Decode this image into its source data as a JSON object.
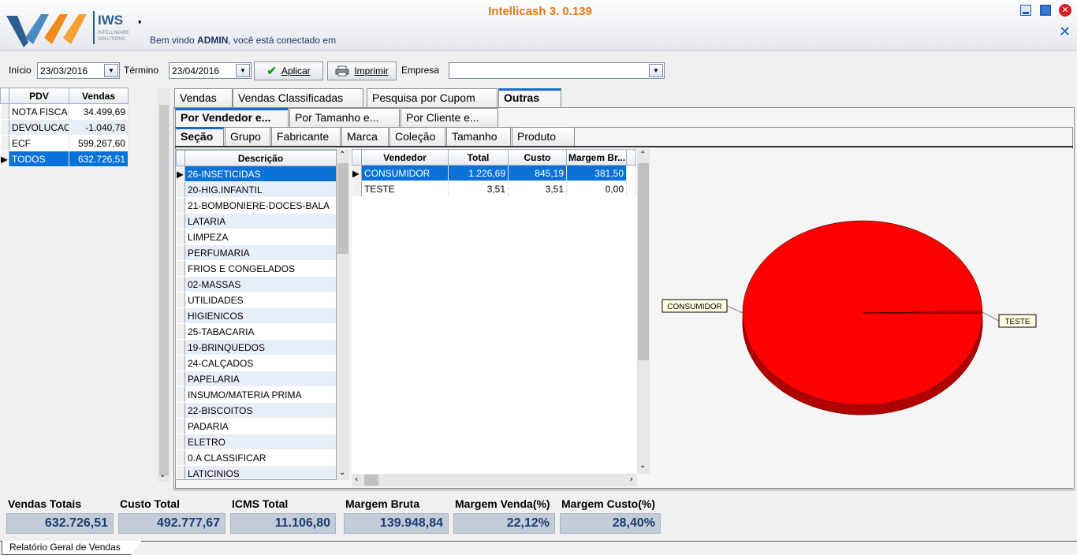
{
  "app": {
    "logo_text": "IWS",
    "logo_sub": "INTELLIWARE SOLUTIONS",
    "title": "Intellicash 3. 0.139"
  },
  "welcome": {
    "prefix": "Bem vindo ",
    "user": "ADMIN",
    "suffix": ", você está conectado em"
  },
  "filters": {
    "inicio_label": "Início",
    "inicio_value": "23/03/2016",
    "termino_label": "Término",
    "termino_value": "23/04/2016",
    "aplicar_label": "Aplicar",
    "imprimir_label": "Imprimir",
    "empresa_label": "Empresa",
    "empresa_value": ""
  },
  "pdv_table": {
    "headers": [
      "PDV",
      "Vendas"
    ],
    "rows": [
      {
        "pdv": "NOTA FISCA",
        "vendas": "34.499,69"
      },
      {
        "pdv": "DEVOLUCAO",
        "vendas": "-1.040,78"
      },
      {
        "pdv": "ECF",
        "vendas": "599.267,60"
      },
      {
        "pdv": "TODOS",
        "vendas": "632.726,51"
      }
    ]
  },
  "tabs_main": [
    "Vendas",
    "Vendas Classificadas",
    "Pesquisa por Cupom",
    "Outras"
  ],
  "tabs_sub": [
    "Por Vendedor e...",
    "Por Tamanho e...",
    "Por Cliente e..."
  ],
  "tabs_inner": [
    "Seção",
    "Grupo",
    "Fabricante",
    "Marca",
    "Coleção",
    "Tamanho",
    "Produto"
  ],
  "desc_table": {
    "header": "Descrição",
    "rows": [
      "26-INSETICIDAS",
      "20-HIG.INFANTIL",
      "21-BOMBONIERE-DOCES-BALA",
      "LATARIA",
      "LIMPEZA",
      "PERFUMARIA",
      "FRIOS E CONGELADOS",
      "02-MASSAS",
      "UTILIDADES",
      "HIGIENICOS",
      "25-TABACARIA",
      "19-BRINQUEDOS",
      "24-CALÇADOS",
      "PAPELARIA",
      "INSUMO/MATERIA PRIMA",
      "22-BISCOITOS",
      "PADARIA",
      "ELETRO",
      "0.A CLASSIFICAR",
      "LATICINIOS"
    ]
  },
  "vend_table": {
    "headers": [
      "Vendedor",
      "Total",
      "Custo",
      "Margem Br..."
    ],
    "rows": [
      {
        "vendedor": "CONSUMIDOR",
        "total": "1.226,69",
        "custo": "845,19",
        "margem": "381,50"
      },
      {
        "vendedor": "TESTE",
        "total": "3,51",
        "custo": "3,51",
        "margem": "0,00"
      }
    ]
  },
  "chart_data": {
    "type": "pie",
    "categories": [
      "CONSUMIDOR",
      "TESTE"
    ],
    "values": [
      1226.69,
      3.51
    ],
    "colors": [
      "#ff0000",
      "#ff0000"
    ]
  },
  "summary": [
    {
      "label": "Vendas Totais",
      "value": "632.726,51"
    },
    {
      "label": "Custo Total",
      "value": "492.777,67"
    },
    {
      "label": "ICMS Total",
      "value": "11.106,80"
    },
    {
      "label": "Margem Bruta",
      "value": "139.948,84"
    },
    {
      "label": "Margem Venda(%)",
      "value": "22,12%"
    },
    {
      "label": "Margem Custo(%)",
      "value": "28,40%"
    }
  ],
  "bottom_tab": "Relatório Geral de Vendas",
  "icons": [
    "logo-icon",
    "menu-arrow-icon",
    "minimize-icon",
    "maximize-icon",
    "close-app-icon",
    "close-tab-icon",
    "check-icon",
    "printer-icon",
    "row-pointer-icon"
  ]
}
